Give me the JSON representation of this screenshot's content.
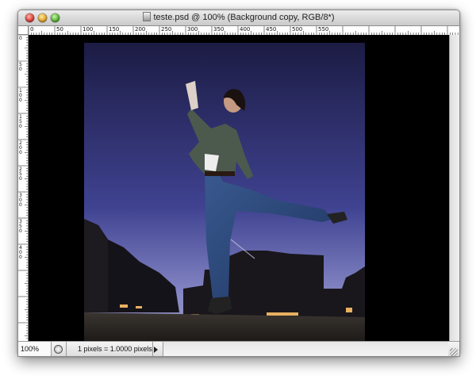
{
  "window": {
    "title": "teste.psd @ 100% (Background copy, RGB/8*)"
  },
  "ruler": {
    "top_labels": [
      "0",
      "50",
      "100",
      "150",
      "200",
      "250",
      "300",
      "350",
      "400",
      "450",
      "500",
      "550"
    ],
    "left_labels": [
      "0",
      "50",
      "100",
      "150",
      "200",
      "250",
      "300",
      "350",
      "400"
    ]
  },
  "canvas": {
    "image_description_icon": "photo-canvas",
    "background_color": "#000000",
    "sky_top_color": "#1f1f4a",
    "sky_bottom_color": "#8a8bc8"
  },
  "statusbar": {
    "zoom": "100%",
    "info": "1 pixels = 1.0000 pixels"
  }
}
